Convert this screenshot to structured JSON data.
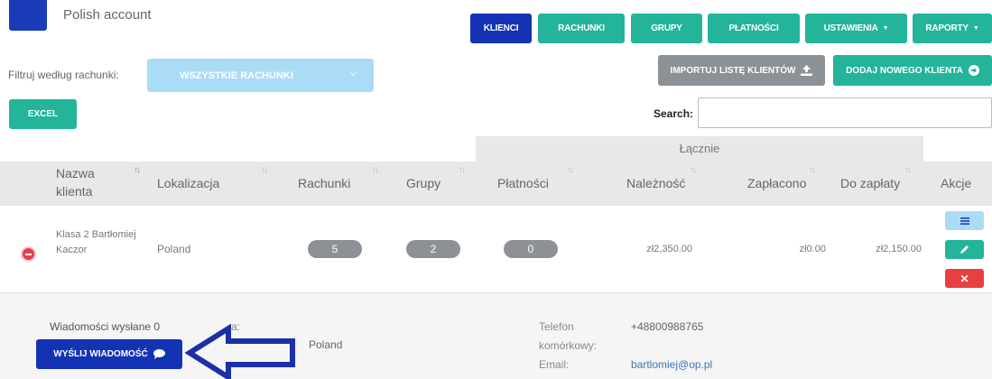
{
  "header": {
    "account_name": "Polish account"
  },
  "nav": {
    "klienci": "KLIENCI",
    "rachunki": "RACHUNKI",
    "grupy": "GRUPY",
    "platnosci": "PŁATNOŚCI",
    "ustawienia": "USTAWIENIA",
    "raporty": "RAPORTY"
  },
  "filter": {
    "label": "Filtruj według rachunki:",
    "selected": "WSZYSTKIE RACHUNKI"
  },
  "actions": {
    "import": "IMPORTUJ LISTĘ KLIENTÓW",
    "add_client": "DODAJ NOWEGO KLIENTA",
    "excel": "EXCEL"
  },
  "search": {
    "label": "Search:",
    "value": ""
  },
  "table": {
    "group_header": "Łącznie",
    "columns": {
      "name_line1": "Nazwa",
      "name_line2": "klienta",
      "location": "Lokalizacja",
      "invoices": "Rachunki",
      "groups": "Grupy",
      "payments": "Płatności",
      "due": "Należność",
      "paid": "Zapłacono",
      "to_pay": "Do zapłaty",
      "actions": "Akcje"
    },
    "row": {
      "name_line1": "Klasa 2 Bartłomiej",
      "name_line2": "Kaczor",
      "location": "Poland",
      "invoices": "5",
      "groups": "2",
      "payments": "0",
      "due": "zł2,350.00",
      "paid": "zł0.00",
      "to_pay": "zł2,150.00"
    }
  },
  "detail": {
    "messages_sent": "Wiadomości wysłane 0",
    "send_button": "WYŚLIJ WIADOMOŚĆ",
    "partial_label": "a:",
    "country": "Poland",
    "phone_label_1": "Telefon",
    "phone_label_2": "komórkowy:",
    "phone": "+48800988765",
    "email_label": "Email:",
    "email": "bartlomiej@op.pl"
  },
  "colors": {
    "primary": "#1433b4",
    "teal": "#23b49a",
    "gray_button": "#8c9196",
    "danger": "#e74040",
    "info": "#aadcf5",
    "annotation_arrow": "#1a2fa8"
  }
}
